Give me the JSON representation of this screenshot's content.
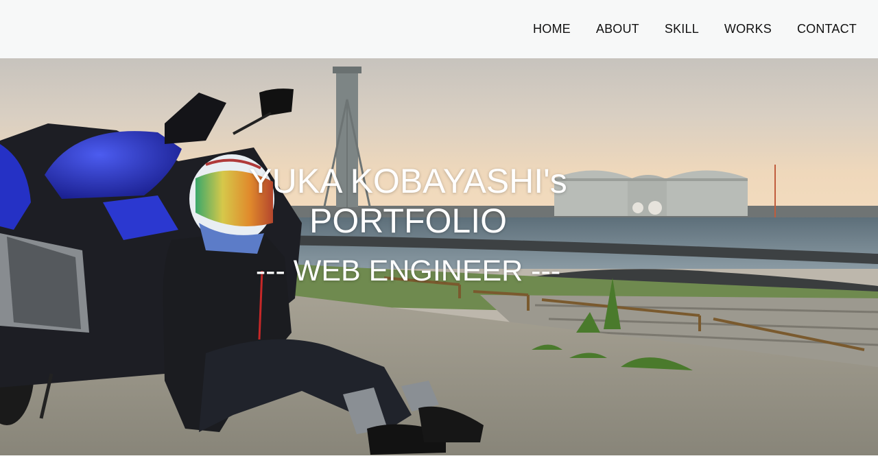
{
  "nav": {
    "items": [
      {
        "label": "HOME"
      },
      {
        "label": "ABOUT"
      },
      {
        "label": "SKILL"
      },
      {
        "label": "WORKS"
      },
      {
        "label": "CONTACT"
      }
    ]
  },
  "hero": {
    "title_line1": "YUKA KOBAYASHI's",
    "title_line2": "PORTFOLIO",
    "subtitle": "--- WEB ENGINEER ---"
  },
  "colors": {
    "header_bg": "#f7f8f8",
    "nav_text": "#111111",
    "hero_text": "#ffffff",
    "motorcycle_blue": "#2430c8"
  }
}
